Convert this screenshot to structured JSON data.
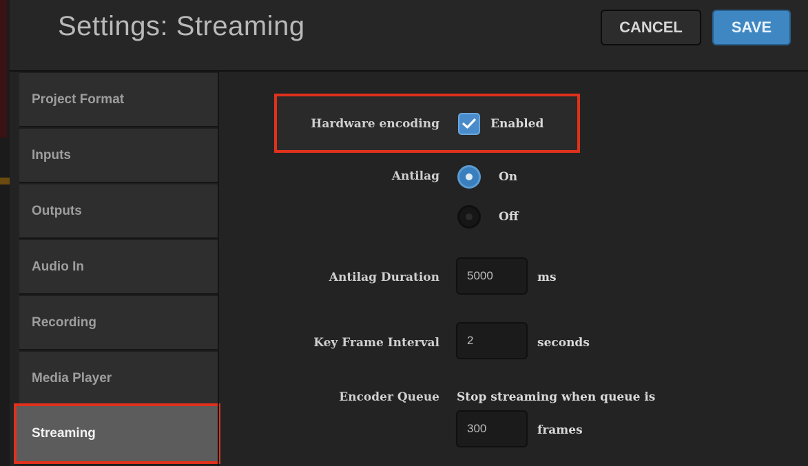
{
  "header": {
    "title": "Settings: Streaming",
    "cancel_label": "CANCEL",
    "save_label": "SAVE"
  },
  "sidebar": {
    "items": [
      {
        "label": "Project Format"
      },
      {
        "label": "Inputs"
      },
      {
        "label": "Outputs"
      },
      {
        "label": "Audio In"
      },
      {
        "label": "Recording"
      },
      {
        "label": "Media Player"
      },
      {
        "label": "Streaming",
        "active": true
      }
    ]
  },
  "form": {
    "hardware_encoding": {
      "label": "Hardware encoding",
      "option": "Enabled",
      "checked": true,
      "icon": "checkmark-icon"
    },
    "antilag": {
      "label": "Antilag",
      "options": [
        "On",
        "Off"
      ],
      "selected": "On"
    },
    "antilag_duration": {
      "label": "Antilag Duration",
      "value": "5000",
      "unit": "ms"
    },
    "key_frame_interval": {
      "label": "Key Frame Interval",
      "value": "2",
      "unit": "seconds"
    },
    "encoder_queue": {
      "label": "Encoder Queue",
      "description": "Stop streaming when queue is",
      "value": "300",
      "unit": "frames"
    }
  },
  "colors": {
    "accent": "#3f87c2",
    "highlight": "#e0311c",
    "background": "#232323"
  }
}
